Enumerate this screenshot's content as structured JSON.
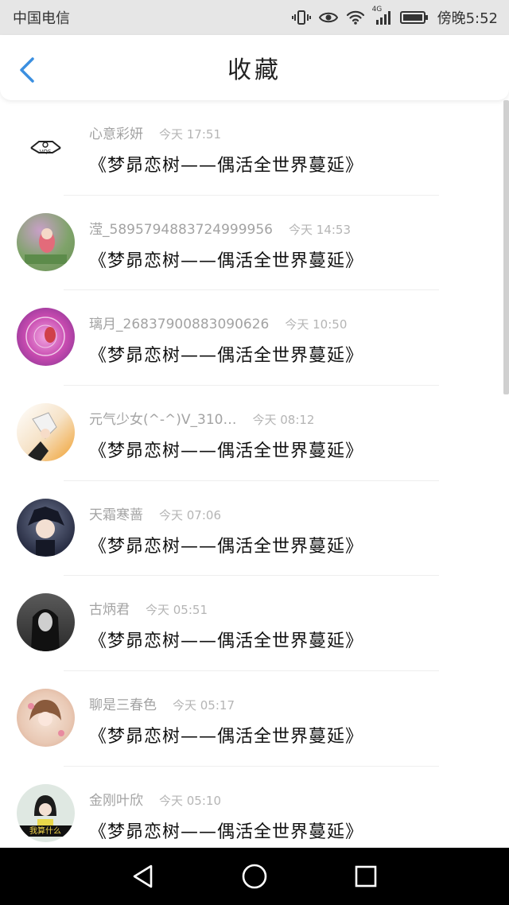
{
  "status_bar": {
    "carrier": "中国电信",
    "network": "4G",
    "time": "傍晚5:52"
  },
  "header": {
    "title": "收藏"
  },
  "favorites": [
    {
      "user": "心意彩妍",
      "time": "今天 17:51",
      "subject": "《梦昴恋树——偶活全世界蔓延》",
      "avatar_color": "#ffffff"
    },
    {
      "user": "滢_5895794883724999956",
      "time": "今天 14:53",
      "subject": "《梦昴恋树——偶活全世界蔓延》",
      "avatar_color": "#8fbf7a"
    },
    {
      "user": "璃月_26837900883090626",
      "time": "今天 10:50",
      "subject": "《梦昴恋树——偶活全世界蔓延》",
      "avatar_color": "#c84bb0"
    },
    {
      "user": "元气少女(^-^)V_310…",
      "time": "今天 08:12",
      "subject": "《梦昴恋树——偶活全世界蔓延》",
      "avatar_color": "#f0a030"
    },
    {
      "user": "天霜寒蔷",
      "time": "今天 07:06",
      "subject": "《梦昴恋树——偶活全世界蔓延》",
      "avatar_color": "#2a2f45"
    },
    {
      "user": "古炳君",
      "time": "今天 05:51",
      "subject": "《梦昴恋树——偶活全世界蔓延》",
      "avatar_color": "#3a3a3a"
    },
    {
      "user": "聊是三春色",
      "time": "今天 05:17",
      "subject": "《梦昴恋树——偶活全世界蔓延》",
      "avatar_color": "#e9c9b5"
    },
    {
      "user": "金刚叶欣",
      "time": "今天 05:10",
      "subject": "《梦昴恋树——偶活全世界蔓延》",
      "avatar_color": "#dfe8e2",
      "avatar_caption": "我算什么"
    }
  ],
  "colors": {
    "accent": "#3b8fe0",
    "status_bar_bg": "#e6e6e6",
    "system_nav_bg": "#000000"
  }
}
